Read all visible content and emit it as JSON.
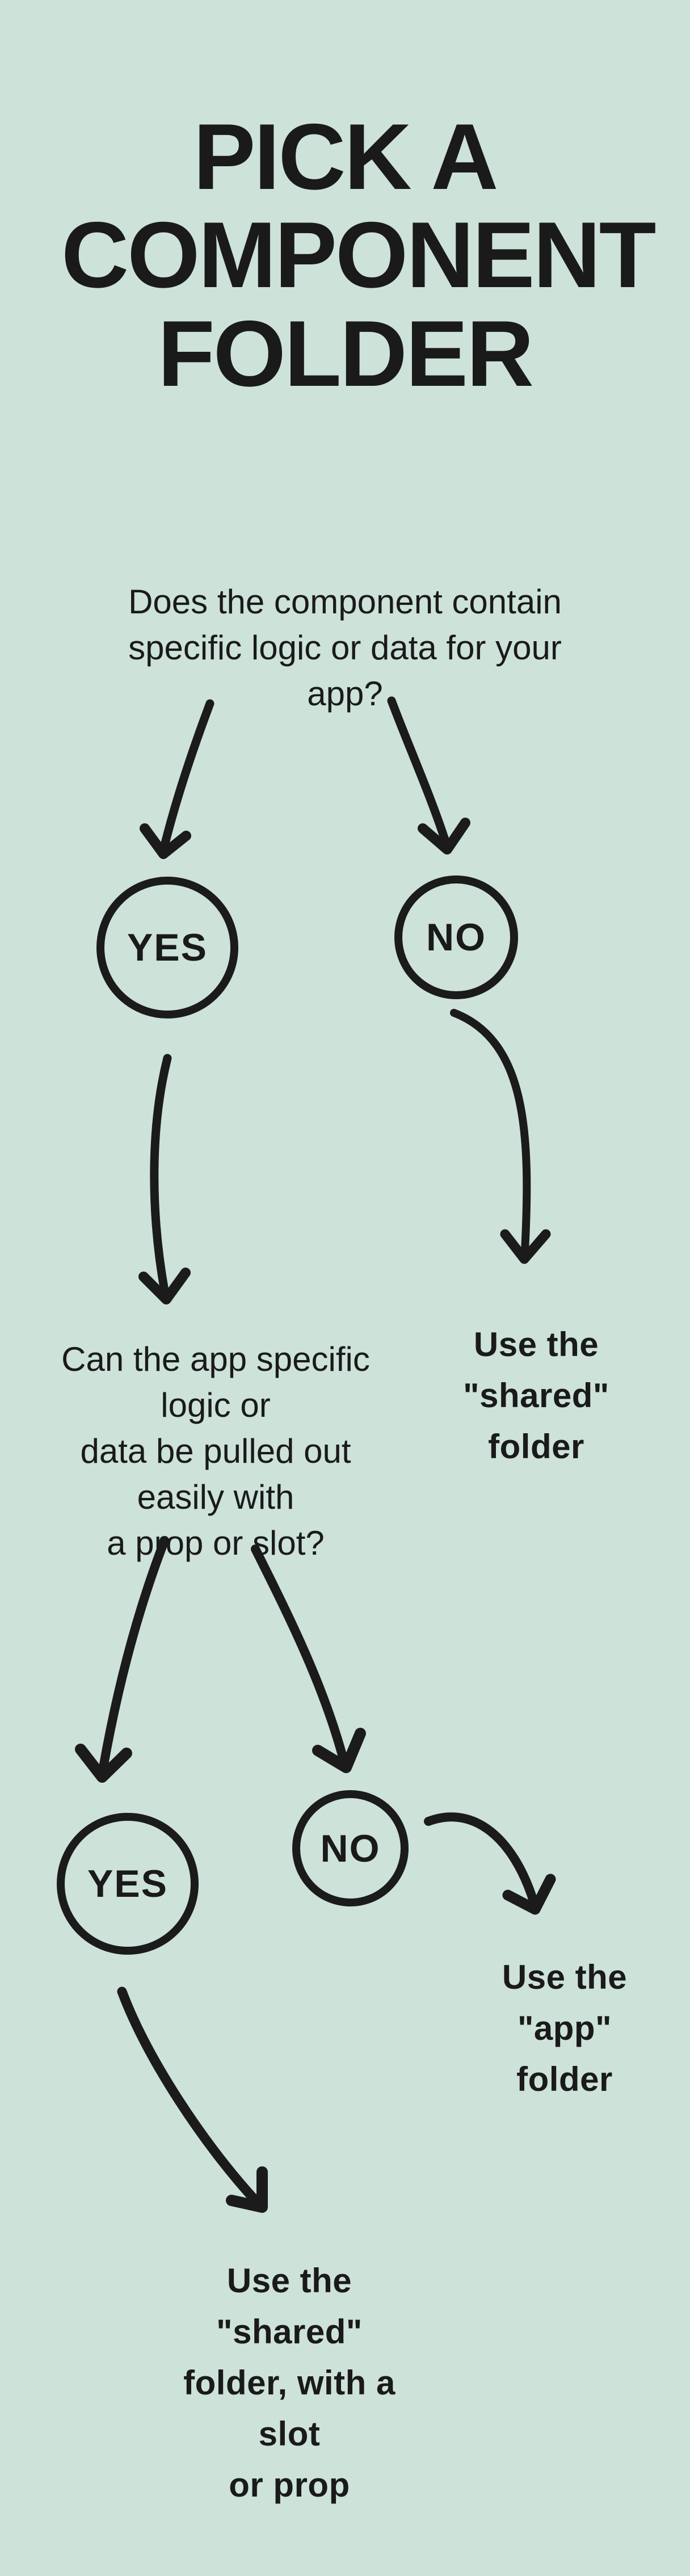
{
  "title": "PICK A COMPONENT FOLDER",
  "q1_line1": "Does the component contain",
  "q1_line2": "specific logic or data for your app?",
  "decision": {
    "yes1": "YES",
    "no1": "NO",
    "yes2": "YES",
    "no2": "NO"
  },
  "q2_line1": "Can the app specific logic or",
  "q2_line2": "data be pulled out easily with",
  "q2_line3": "a prop or slot?",
  "r1_line1": "Use the \"shared\"",
  "r1_line2": "folder",
  "r2_line1": "Use the \"app\"",
  "r2_line2": "folder",
  "r3_line1": "Use the \"shared\"",
  "r3_line2": "folder, with a slot",
  "r3_line3": "or prop"
}
